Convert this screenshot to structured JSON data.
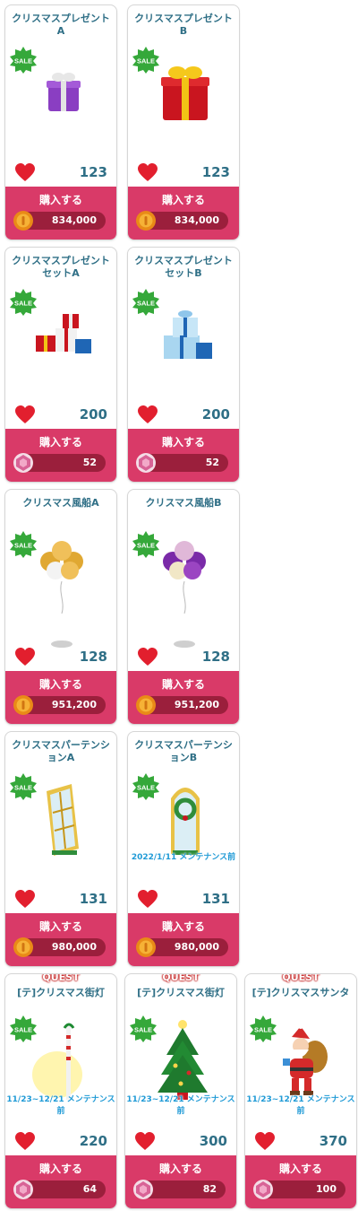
{
  "labels": {
    "buy": "購入する",
    "sale": "SALE",
    "quest": "QUEST"
  },
  "items": [
    {
      "title": "クリスマスプレゼント\nA",
      "likes": "123",
      "price": "834,000",
      "currency": "coin",
      "notice": ""
    },
    {
      "title": "クリスマスプレゼント\nB",
      "likes": "123",
      "price": "834,000",
      "currency": "coin",
      "notice": ""
    },
    {
      "title": "クリスマスプレゼント\nセットA",
      "likes": "200",
      "price": "52",
      "currency": "gem",
      "notice": ""
    },
    {
      "title": "クリスマスプレゼント\nセットB",
      "likes": "200",
      "price": "52",
      "currency": "gem",
      "notice": ""
    },
    {
      "title": "クリスマス風船A",
      "likes": "128",
      "price": "951,200",
      "currency": "coin",
      "notice": ""
    },
    {
      "title": "クリスマス風船B",
      "likes": "128",
      "price": "951,200",
      "currency": "coin",
      "notice": ""
    },
    {
      "title": "クリスマスパーテンシ\nョンA",
      "likes": "131",
      "price": "980,000",
      "currency": "coin",
      "notice": ""
    },
    {
      "title": "クリスマスパーテンシ\nョンB",
      "likes": "131",
      "price": "980,000",
      "currency": "coin",
      "notice": "2022/1/11 メンテナンス前"
    },
    {
      "title": "[テ]クリスマス街灯",
      "likes": "220",
      "price": "64",
      "currency": "gem",
      "notice": "11/23~12/21 メンテナンス前"
    },
    {
      "title": "[テ]クリスマス街灯",
      "likes": "300",
      "price": "82",
      "currency": "gem",
      "notice": "11/23~12/21 メンテナンス前"
    },
    {
      "title": "[テ]クリスマスサンタ",
      "likes": "370",
      "price": "100",
      "currency": "gem",
      "notice": "11/23~12/21 メンテナンス前"
    }
  ],
  "colors": {
    "accent": "#d93a68",
    "priceBar": "#9b1f3c",
    "titleText": "#2f6f86",
    "saleGreen": "#35a83a"
  }
}
